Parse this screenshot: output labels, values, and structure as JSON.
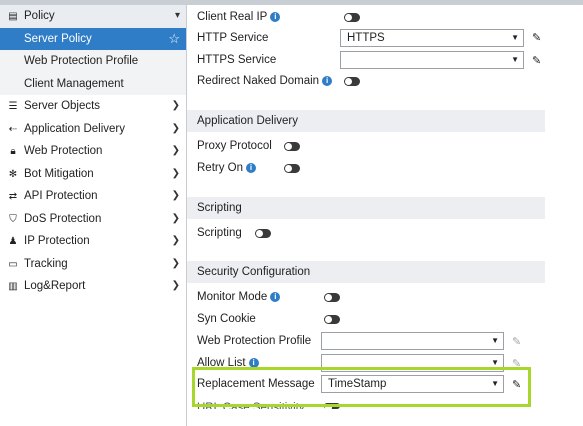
{
  "sidebar": {
    "items": [
      {
        "label": "Policy",
        "icon": "document-icon"
      },
      {
        "label": "Server Policy"
      },
      {
        "label": "Web Protection Profile"
      },
      {
        "label": "Client Management"
      },
      {
        "label": "Server Objects",
        "icon": "list-icon"
      },
      {
        "label": "Application Delivery",
        "icon": "delivery-icon"
      },
      {
        "label": "Web Protection",
        "icon": "lock-icon"
      },
      {
        "label": "Bot Mitigation",
        "icon": "bot-icon"
      },
      {
        "label": "API Protection",
        "icon": "api-icon"
      },
      {
        "label": "DoS Protection",
        "icon": "shield-icon"
      },
      {
        "label": "IP Protection",
        "icon": "ip-icon"
      },
      {
        "label": "Tracking",
        "icon": "tracking-icon"
      },
      {
        "label": "Log&Report",
        "icon": "chart-icon"
      }
    ]
  },
  "form": {
    "client_real_ip": "Client Real IP",
    "http_service": {
      "label": "HTTP Service",
      "value": "HTTPS"
    },
    "https_service": {
      "label": "HTTPS Service",
      "value": ""
    },
    "redirect_naked_domain": "Redirect Naked Domain",
    "sections": {
      "app_delivery": "Application Delivery",
      "scripting": "Scripting",
      "security": "Security Configuration"
    },
    "proxy_protocol": "Proxy Protocol",
    "retry_on": "Retry On",
    "scripting": "Scripting",
    "monitor_mode": "Monitor Mode",
    "syn_cookie": "Syn Cookie",
    "web_protection_profile": {
      "label": "Web Protection Profile",
      "value": ""
    },
    "allow_list": {
      "label": "Allow List",
      "value": ""
    },
    "replacement_message": {
      "label": "Replacement Message",
      "value": "TimeStamp"
    },
    "url_case_sensitivity": "URL Case Sensitivity"
  },
  "colors": {
    "accent": "#2e7dc6",
    "highlight": "#a6d72a"
  }
}
